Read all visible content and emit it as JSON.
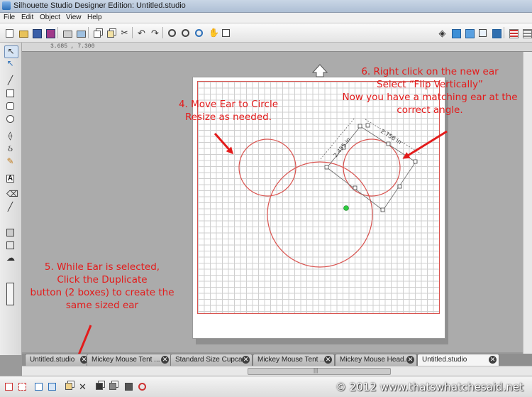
{
  "window": {
    "title": "Silhouette Studio Designer Edition: Untitled.studio"
  },
  "menu": [
    "File",
    "Edit",
    "Object",
    "View",
    "Help"
  ],
  "ruler": {
    "coords": "3.685 , 7.300"
  },
  "annotations": {
    "step4": [
      "4.  Move Ear to Circle",
      "Resize as needed."
    ],
    "step5": [
      "5.  While Ear is selected,",
      "Click the Duplicate",
      "button (2 boxes) to create the",
      "same sized ear"
    ],
    "step6": [
      "6.  Right click on the new ear",
      "Select “Flip Vertically”",
      "Now you have a matching ear at the",
      "correct angle."
    ]
  },
  "dimensions": {
    "width_label": "2.455 in",
    "height_label": "2.756 in"
  },
  "tabs": [
    {
      "label": "Untitled.studio",
      "active": false
    },
    {
      "label": "Mickey Mouse Tent ...",
      "active": false
    },
    {
      "label": "Standard Size Cupca...",
      "active": false
    },
    {
      "label": "Mickey Mouse Tent ...",
      "active": false
    },
    {
      "label": "Mickey Mouse Head...",
      "active": false
    },
    {
      "label": "Untitled.studio",
      "active": true
    }
  ],
  "scroll_grip": "|||",
  "copyright": "© 2012 www.thatswhatchesaid.net",
  "colors": {
    "annotation": "#e31b1b",
    "cut_line": "#d9534f",
    "center_dot": "#2ecc40"
  }
}
